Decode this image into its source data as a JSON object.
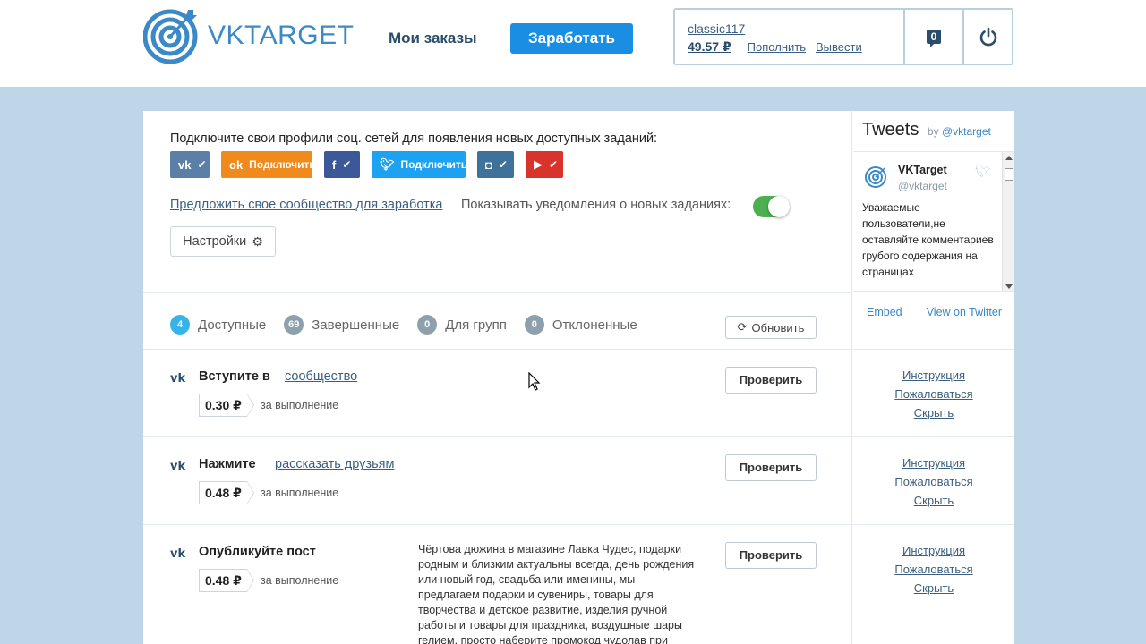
{
  "header": {
    "logo_text": "VKTARGET",
    "nav_orders": "Мои заказы",
    "earn_button": "Заработать",
    "user": {
      "username": "classic117",
      "balance": "49.57 ₽",
      "topup": "Пополнить",
      "withdraw": "Вывести",
      "messages_count": "0"
    }
  },
  "connect": {
    "prompt": "Подключите свои профили соц. сетей для появления новых доступных заданий:",
    "networks": [
      {
        "name": "vk",
        "icon": "vk-icon",
        "label": ""
      },
      {
        "name": "ok",
        "icon": "odnoklassniki-icon",
        "label": "Подключить"
      },
      {
        "name": "facebook",
        "icon": "facebook-icon",
        "label": ""
      },
      {
        "name": "twitter",
        "icon": "twitter-icon",
        "label": "Подключить"
      },
      {
        "name": "instagram",
        "icon": "instagram-icon",
        "label": ""
      },
      {
        "name": "youtube",
        "icon": "youtube-icon",
        "label": ""
      }
    ],
    "suggest_link": "Предложить свое сообщество для заработка",
    "notify_label": "Показывать уведомления о новых заданиях:",
    "notify_enabled": true,
    "settings_button": "Настройки"
  },
  "tabs": [
    {
      "count": "4",
      "label": "Доступные",
      "active": true
    },
    {
      "count": "69",
      "label": "Завершенные",
      "active": false
    },
    {
      "count": "0",
      "label": "Для групп",
      "active": false
    },
    {
      "count": "0",
      "label": "Отклоненные",
      "active": false
    }
  ],
  "refresh_button": "Обновить",
  "tasks": [
    {
      "title": "Вступите в",
      "link": "сообщество",
      "price": "0.30 ₽",
      "per": "за выполнение",
      "check": "Проверить",
      "text": ""
    },
    {
      "title": "Нажмите",
      "link": "рассказать друзьям",
      "price": "0.48 ₽",
      "per": "за выполнение",
      "check": "Проверить",
      "text": ""
    },
    {
      "title": "Опубликуйте пост",
      "link": "",
      "price": "0.48 ₽",
      "per": "за выполнение",
      "check": "Проверить",
      "text": "Чёртова дюжина в магазине Лавка Чудес, подарки родным и близким актуальны всегда, день рождения или новый год, свадьба или именины, мы предлагаем подарки и сувениры, товары для творчества и детское развитие, изделия ручной работы и товары для праздника, воздушные шары гелием, просто наберите промокод чудолав при"
    }
  ],
  "task_side_links": {
    "instruction": "Инструкция",
    "complain": "Пожаловаться",
    "hide": "Скрыть"
  },
  "tweets": {
    "title": "Tweets",
    "by": "by",
    "handle_link": "@vktarget",
    "author_name": "VKTarget",
    "author_handle": "@vktarget",
    "text": "Уважаемые пользователи,не оставляйте комментариев грубого содержания на страницах",
    "embed": "Embed",
    "view_on_twitter": "View on Twitter"
  },
  "colors": {
    "accent": "#1a8ee3",
    "page_bg": "#bfd6e8",
    "link": "#3a5f80",
    "toggle_on": "#4caf50"
  }
}
